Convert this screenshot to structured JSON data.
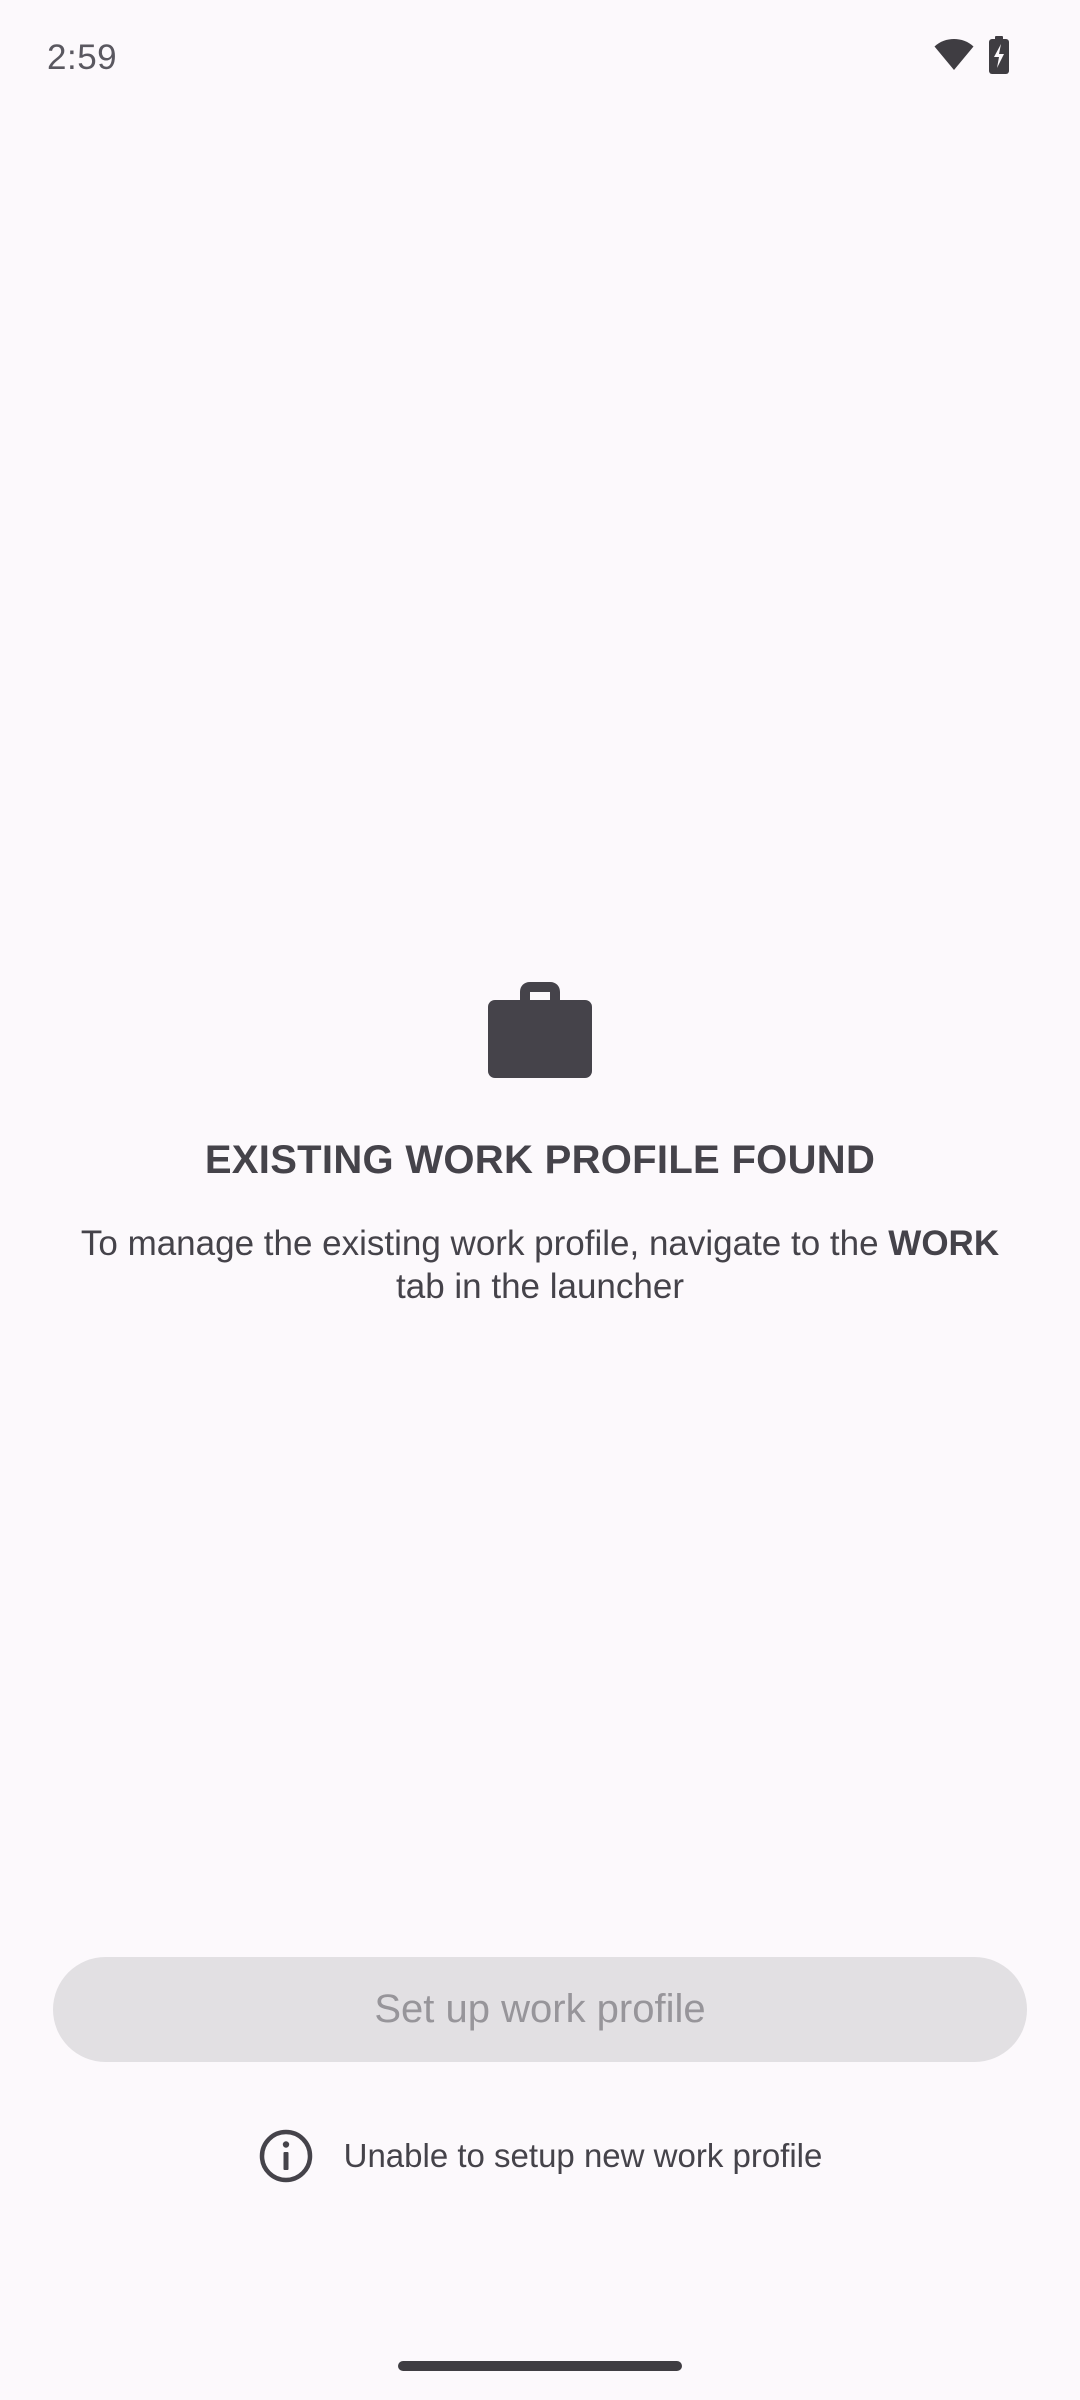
{
  "status_bar": {
    "time": "2:59",
    "icons": [
      "wifi-icon",
      "battery-charging-icon"
    ]
  },
  "main": {
    "icon": "briefcase-icon",
    "title": "EXISTING WORK PROFILE FOUND",
    "description_before": "To manage the existing work profile, navigate to the ",
    "description_bold": "WORK",
    "description_after": " tab in the launcher"
  },
  "actions": {
    "setup_button_label": "Set up work profile",
    "setup_button_enabled": false
  },
  "info": {
    "icon": "info-icon",
    "text": "Unable to setup new work profile"
  },
  "colors": {
    "background": "#fcf9fc",
    "text": "#45434a",
    "button_disabled_bg": "#e2e0e3",
    "button_disabled_text": "#97959a"
  }
}
